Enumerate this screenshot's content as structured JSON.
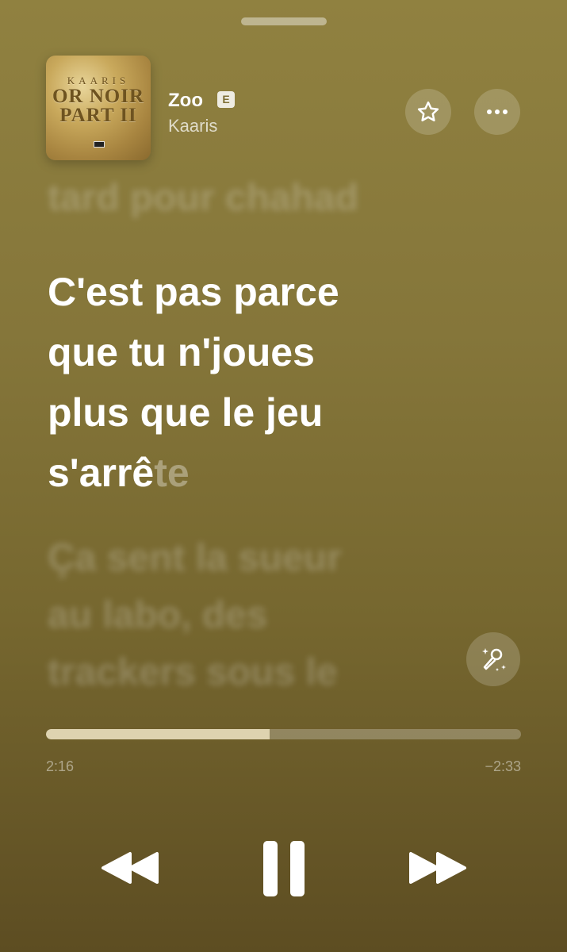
{
  "player": {
    "song_title": "Zoo",
    "explicit_badge": "E",
    "artist": "Kaaris",
    "album_art": {
      "artist_text": "KAARIS",
      "title_line1": "OR NOIR",
      "title_line2": "PART II"
    }
  },
  "lyrics": {
    "previous_line": "tard pour chahad",
    "current_lines": [
      "C'est pas parce",
      "que tu n'joues",
      "plus que le jeu"
    ],
    "current_last_sung": "s'arrê",
    "current_last_unsung": "te",
    "next_lines": [
      "Ça sent la sueur",
      "au labo, des",
      "trackers sous le"
    ]
  },
  "progress": {
    "elapsed": "2:16",
    "remaining": "−2:33",
    "fraction": 0.47
  },
  "icons": {
    "star": "star-icon",
    "more": "ellipsis-icon",
    "sing": "microphone-sparkle-icon",
    "rewind": "rewind-icon",
    "pause": "pause-icon",
    "forward": "fast-forward-icon"
  },
  "colors": {
    "background_top": "#908140",
    "background_bottom": "#5d4d22",
    "progress_fill": "#ebe1be"
  }
}
